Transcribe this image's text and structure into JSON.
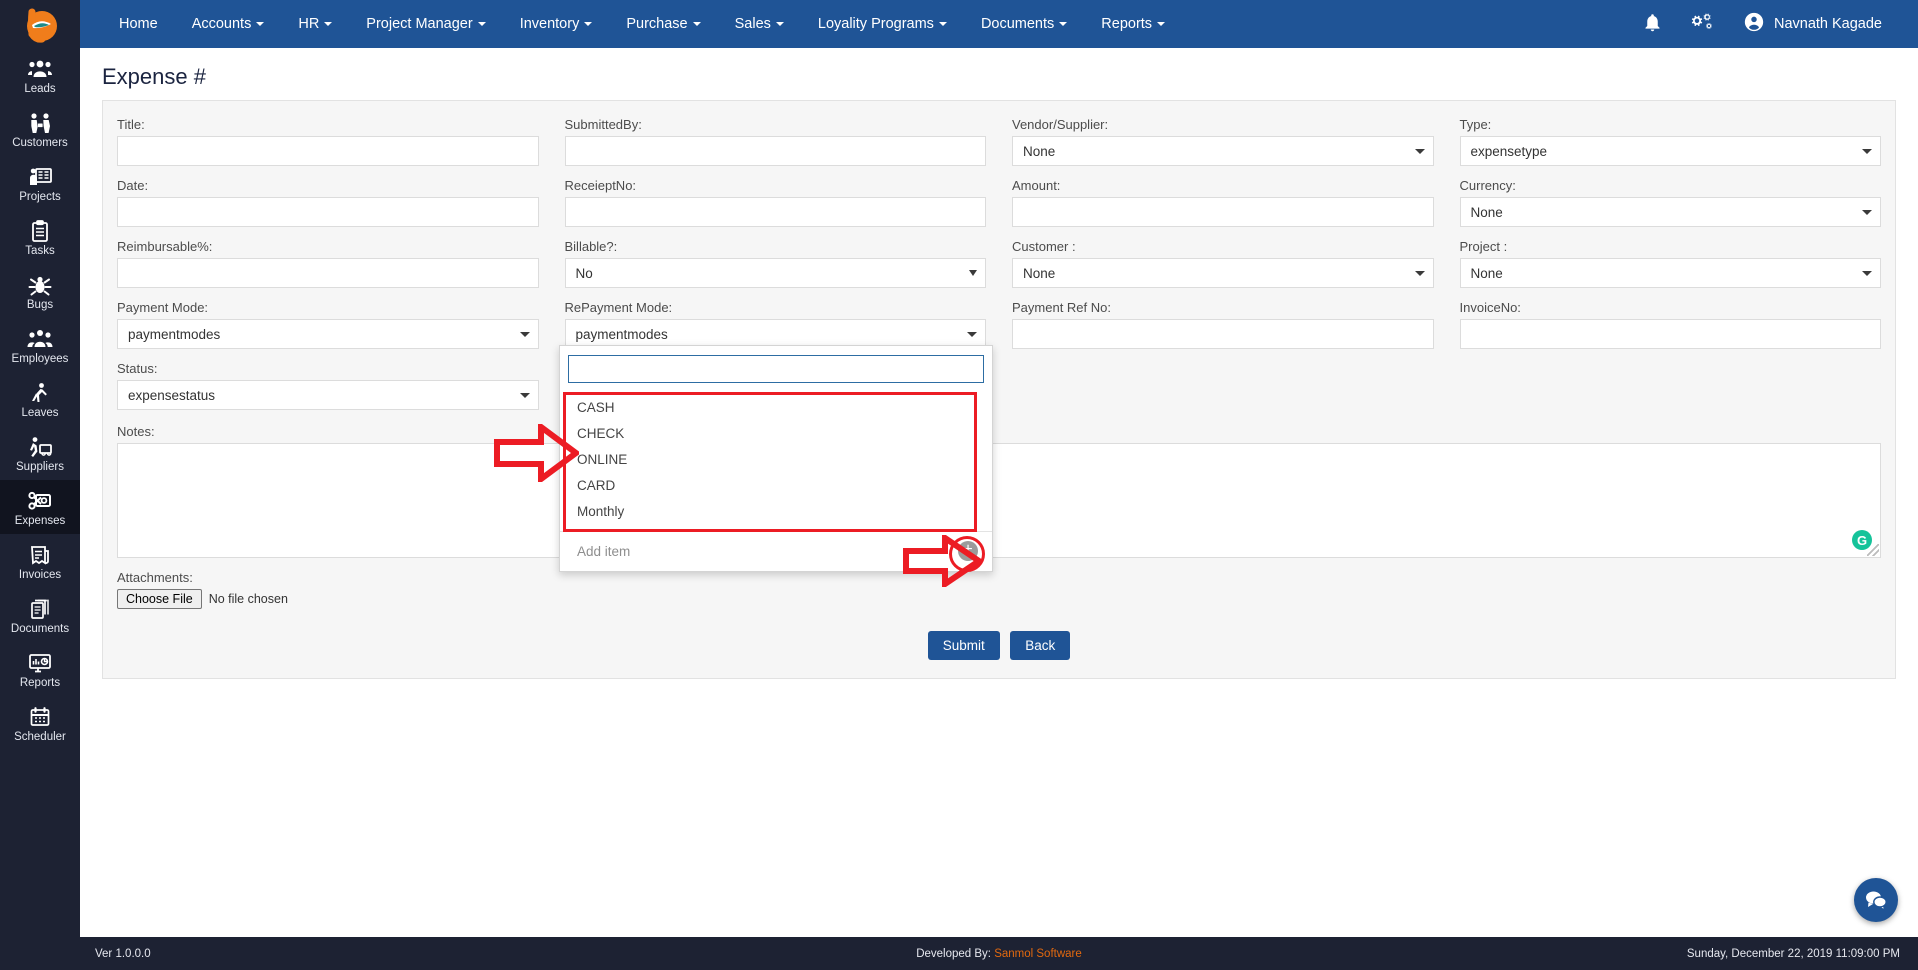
{
  "app": {
    "brand_icon": "logo-e-icon",
    "accent_color": "#1f5496",
    "sidebar_color": "#1d2233"
  },
  "topnav": {
    "links": [
      {
        "label": "Home",
        "has_caret": false
      },
      {
        "label": "Accounts",
        "has_caret": true
      },
      {
        "label": "HR",
        "has_caret": true
      },
      {
        "label": "Project Manager",
        "has_caret": true
      },
      {
        "label": "Inventory",
        "has_caret": true
      },
      {
        "label": "Purchase",
        "has_caret": true
      },
      {
        "label": "Sales",
        "has_caret": true
      },
      {
        "label": "Loyality Programs",
        "has_caret": true
      },
      {
        "label": "Documents",
        "has_caret": true
      },
      {
        "label": "Reports",
        "has_caret": true
      }
    ],
    "notification_icon": "bell-icon",
    "settings_icon": "gears-icon",
    "user_icon": "user-avatar-icon",
    "user_name": "Navnath Kagade"
  },
  "sidebar": {
    "items": [
      {
        "label": "Leads",
        "icon": "leads-icon",
        "active": false
      },
      {
        "label": "Customers",
        "icon": "customers-icon",
        "active": false
      },
      {
        "label": "Projects",
        "icon": "projects-icon",
        "active": false
      },
      {
        "label": "Tasks",
        "icon": "tasks-icon",
        "active": false
      },
      {
        "label": "Bugs",
        "icon": "bug-icon",
        "active": false
      },
      {
        "label": "Employees",
        "icon": "employees-icon",
        "active": false
      },
      {
        "label": "Leaves",
        "icon": "leaves-icon",
        "active": false
      },
      {
        "label": "Suppliers",
        "icon": "suppliers-icon",
        "active": false
      },
      {
        "label": "Expenses",
        "icon": "expenses-icon",
        "active": true
      },
      {
        "label": "Invoices",
        "icon": "invoices-icon",
        "active": false
      },
      {
        "label": "Documents",
        "icon": "documents-icon",
        "active": false
      },
      {
        "label": "Reports",
        "icon": "reports-icon",
        "active": false
      },
      {
        "label": "Scheduler",
        "icon": "calendar-icon",
        "active": false
      }
    ]
  },
  "page": {
    "title": "Expense #"
  },
  "form": {
    "col1": [
      {
        "label": "Title:",
        "type": "text",
        "value": "",
        "placeholder": ""
      },
      {
        "label": "Date:",
        "type": "text",
        "value": "",
        "placeholder": ""
      },
      {
        "label": "Reimbursable%:",
        "type": "text",
        "value": "",
        "placeholder": ""
      },
      {
        "label": "Payment Mode:",
        "type": "select",
        "value": "paymentmodes"
      },
      {
        "label": "Status:",
        "type": "select",
        "value": "expensestatus"
      }
    ],
    "col2": [
      {
        "label": "SubmittedBy:",
        "type": "text",
        "value": "",
        "placeholder": ""
      },
      {
        "label": "ReceieptNo:",
        "type": "text",
        "value": "",
        "placeholder": ""
      },
      {
        "label": "Billable?:",
        "type": "native",
        "value": "No"
      },
      {
        "label": "RePayment Mode:",
        "type": "select",
        "value": "paymentmodes"
      }
    ],
    "col3": [
      {
        "label": "Vendor/Supplier:",
        "type": "select",
        "value": "None"
      },
      {
        "label": "Amount:",
        "type": "text",
        "value": "",
        "placeholder": ""
      },
      {
        "label": "Customer :",
        "type": "select",
        "value": "None"
      },
      {
        "label": "Payment Ref No:",
        "type": "text",
        "value": "",
        "placeholder": ""
      }
    ],
    "col4": [
      {
        "label": "Type:",
        "type": "select",
        "value": "expensetype"
      },
      {
        "label": "Currency:",
        "type": "select",
        "value": "None"
      },
      {
        "label": "Project :",
        "type": "select",
        "value": "None"
      },
      {
        "label": "InvoiceNo:",
        "type": "text",
        "value": "",
        "placeholder": ""
      }
    ],
    "notes": {
      "label": "Notes:",
      "value": "",
      "placeholder": "",
      "grammarly_badge": "G"
    },
    "attachments": {
      "label": "Attachments:",
      "button_label": "Choose File",
      "status": "No file chosen"
    },
    "actions": {
      "submit_label": "Submit",
      "back_label": "Back"
    }
  },
  "dropdown": {
    "search_value": "",
    "search_placeholder": "",
    "options": [
      "CASH",
      "CHECK",
      "ONLINE",
      "CARD",
      "Monthly"
    ],
    "add_item_label": "Add item",
    "add_icon": "plus-circle-icon"
  },
  "annotations": {
    "highlight_color": "#ec1c24"
  },
  "footer": {
    "version": "Ver 1.0.0.0",
    "developed_by_label": "Developed By:",
    "developer": "Sanmol Software",
    "datetime": "Sunday, December 22, 2019 11:09:00 PM"
  },
  "chat": {
    "icon": "chat-bubble-icon"
  }
}
